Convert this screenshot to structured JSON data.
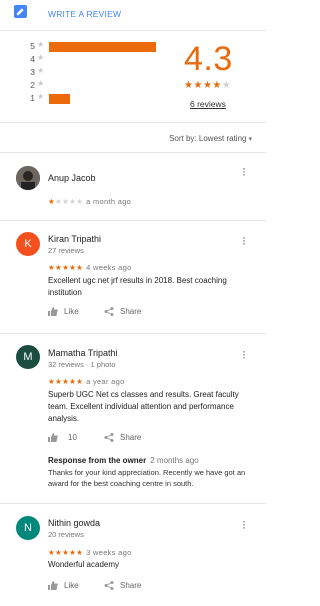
{
  "write_review": {
    "label": "WRITE A REVIEW"
  },
  "histogram": [
    {
      "star": "5",
      "fraction": 1.0
    },
    {
      "star": "4",
      "fraction": 0.0
    },
    {
      "star": "3",
      "fraction": 0.0
    },
    {
      "star": "2",
      "fraction": 0.0
    },
    {
      "star": "1",
      "fraction": 0.2
    }
  ],
  "summary": {
    "score": "4.3",
    "stars_filled": 4,
    "stars_total": 5,
    "review_count": "6 reviews"
  },
  "sort": {
    "label": "Sort by:",
    "value": "Lowest rating"
  },
  "reviews": [
    {
      "name": "Anup Jacob",
      "meta": "",
      "avatar_letter": "",
      "avatar_color": "#3b3b3b",
      "stars": 1,
      "when": "a month ago",
      "text": "",
      "likes": "",
      "like_label": "",
      "share_label": ""
    },
    {
      "name": "Kiran Tripathi",
      "meta": "27 reviews",
      "avatar_letter": "K",
      "avatar_color": "#f4511e",
      "stars": 5,
      "when": "4 weeks ago",
      "text": "Excellent ugc net jrf results in 2018. Best coaching institution",
      "likes": "",
      "like_label": "Like",
      "share_label": "Share"
    },
    {
      "name": "Mamatha Tripathi",
      "meta": "32 reviews · 1 photo",
      "avatar_letter": "M",
      "avatar_color": "#1b4d3e",
      "stars": 5,
      "when": "a year ago",
      "text": "Superb UGC Net cs classes and results.  Great faculty team. Excellent individual attention and performance analysis.",
      "likes": "10",
      "like_label": "",
      "share_label": "Share",
      "owner_response": {
        "title": "Response from the owner",
        "when": "2 months ago",
        "text": "Thanks for your kind appreciation. Recently we have got an award for the best coaching centre in south."
      }
    },
    {
      "name": "Nithin gowda",
      "meta": "20 reviews",
      "avatar_letter": "N",
      "avatar_color": "#00897b",
      "stars": 5,
      "when": "3 weeks ago",
      "text": "Wonderful academy",
      "likes": "",
      "like_label": "Like",
      "share_label": "Share"
    }
  ],
  "colors": {
    "accent": "#ea6a0c",
    "link": "#4285f4"
  },
  "icons": [
    "pencil-icon",
    "star-icon",
    "more-vert-icon",
    "thumb-up-icon",
    "share-icon",
    "chevron-down-icon"
  ]
}
